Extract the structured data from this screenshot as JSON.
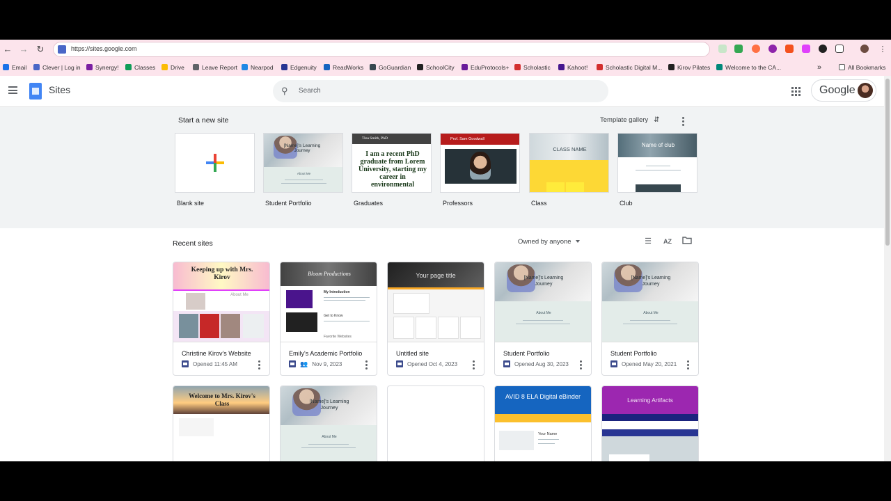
{
  "browser": {
    "url": "https://sites.google.com",
    "bookmarks": [
      {
        "label": "Email",
        "color": "#1a73e8"
      },
      {
        "label": "Clever | Log in",
        "color": "#4a67c7"
      },
      {
        "label": "Synergy!",
        "color": "#7b1fa2"
      },
      {
        "label": "Classes",
        "color": "#0f9d58"
      },
      {
        "label": "Drive",
        "color": "#fbbc04"
      },
      {
        "label": "Leave Report",
        "color": "#5f6368"
      },
      {
        "label": "Nearpod",
        "color": "#1e88e5"
      },
      {
        "label": "Edgenuity",
        "color": "#283593"
      },
      {
        "label": "ReadWorks",
        "color": "#1565c0"
      },
      {
        "label": "GoGuardian",
        "color": "#37474f"
      },
      {
        "label": "SchoolCity",
        "color": "#212121"
      },
      {
        "label": "EduProtocols+",
        "color": "#6a1b9a"
      },
      {
        "label": "Scholastic",
        "color": "#d32f2f"
      },
      {
        "label": "Kahoot!",
        "color": "#46178f"
      },
      {
        "label": "Scholastic Digital M...",
        "color": "#d32f2f"
      },
      {
        "label": "Kirov Pilates",
        "color": "#212121"
      },
      {
        "label": "Welcome to the CA...",
        "color": "#00897b"
      }
    ],
    "more_label": "»",
    "all_bookmarks": "All Bookmarks"
  },
  "app": {
    "title": "Sites",
    "search_placeholder": "Search",
    "account_label": "Google"
  },
  "templates": {
    "section_title": "Start a new site",
    "gallery_label": "Template gallery",
    "items": [
      {
        "label": "Blank site"
      },
      {
        "label": "Student Portfolio",
        "thumb_title": "[Name]'s Learning Journey",
        "thumb_sub": "About Me"
      },
      {
        "label": "Graduates",
        "thumb_header": "Tina Smith, PhD",
        "thumb_text": "I am a recent PhD graduate from Lorem University, starting my career in environmental"
      },
      {
        "label": "Professors",
        "thumb_header": "Prof. Sam Goodwall"
      },
      {
        "label": "Class",
        "thumb_title": "CLASS NAME"
      },
      {
        "label": "Club",
        "thumb_title": "Name of club"
      }
    ]
  },
  "recent": {
    "section_title": "Recent sites",
    "owner_filter": "Owned by anyone",
    "sites": [
      {
        "name": "Christine Kirov's Website",
        "meta": "Opened 11:45 AM",
        "thumb_title": "Keeping up with Mrs. Kirov",
        "thumb_sub": "About Me",
        "shared": false
      },
      {
        "name": "Emily's Academic Portfolio",
        "meta": "Nov 9, 2023",
        "thumb_title": "Bloom Productions",
        "thumb_sub": "My Introduction",
        "thumb_sub2": "Get to Know",
        "thumb_sub3": "Favorite Websites",
        "shared": true
      },
      {
        "name": "Untitled site",
        "meta": "Opened Oct 4, 2023",
        "thumb_title": "Your page title",
        "shared": false
      },
      {
        "name": "Student Portfolio",
        "meta": "Opened Aug 30, 2023",
        "thumb_title": "[Name]'s Learning Journey",
        "thumb_sub": "About Me",
        "shared": false
      },
      {
        "name": "Student Portfolio",
        "meta": "Opened May 20, 2021",
        "thumb_title": "[Name]'s Learning Journey",
        "thumb_sub": "About Me",
        "shared": false
      }
    ],
    "row2": [
      {
        "thumb_title": "Welcome to Mrs. Kirov's Class"
      },
      {
        "thumb_title": "[Name]'s Learning Journey",
        "thumb_sub": "About Me"
      },
      {
        "thumb_title": ""
      },
      {
        "thumb_title": "AVID 8 ELA Digital eBinder",
        "thumb_sub": "Your Name"
      },
      {
        "thumb_title": "Learning Artifacts"
      }
    ]
  }
}
